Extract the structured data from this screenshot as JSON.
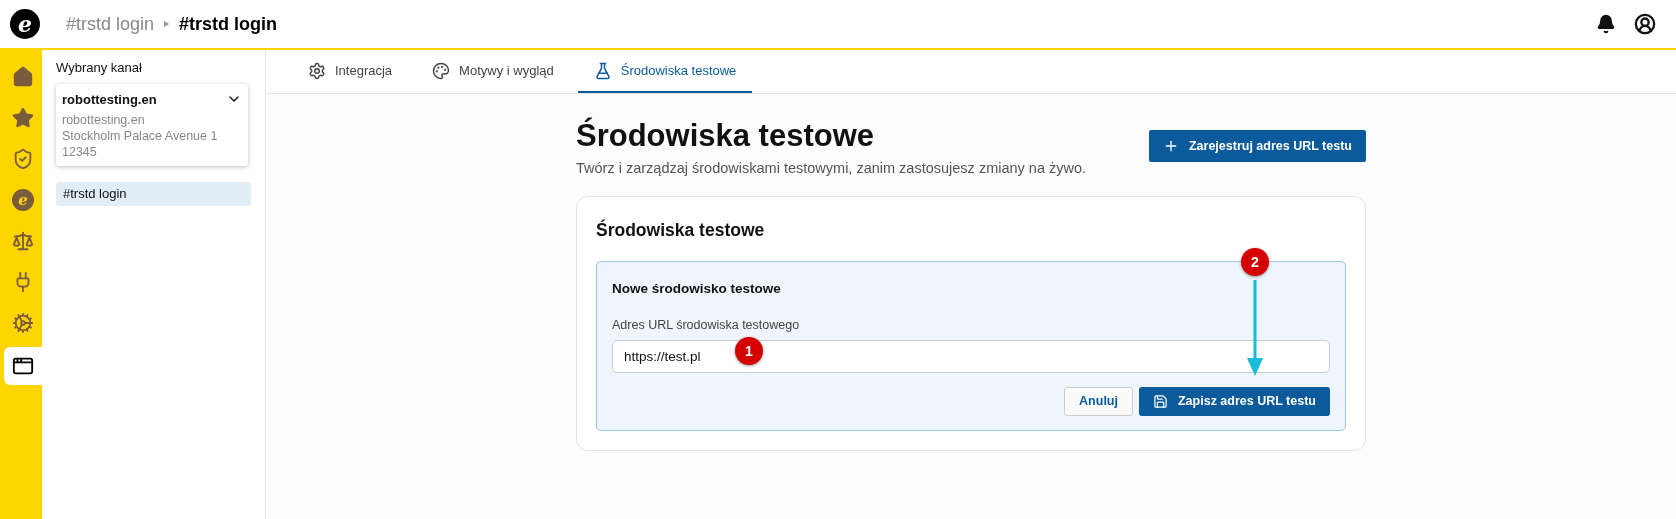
{
  "header": {
    "logo": "e",
    "breadcrumb": [
      {
        "label": "#trstd login",
        "current": false
      },
      {
        "label": "#trstd login",
        "current": true
      }
    ]
  },
  "rail": [
    {
      "kind": "home",
      "selected": false
    },
    {
      "kind": "star",
      "selected": false
    },
    {
      "kind": "shield",
      "selected": false
    },
    {
      "kind": "logo",
      "glyph": "e",
      "selected": false
    },
    {
      "kind": "scale",
      "selected": false
    },
    {
      "kind": "plug",
      "selected": false
    },
    {
      "kind": "gear",
      "selected": false
    },
    {
      "kind": "window",
      "selected": true
    }
  ],
  "sidebar": {
    "label": "Wybrany kanał",
    "channel": {
      "name": "robottesting.en",
      "lines": [
        "robottesting.en",
        "Stockholm Palace Avenue 1",
        "12345"
      ]
    },
    "items": [
      {
        "label": "#trstd login",
        "selected": true
      }
    ]
  },
  "tabs": [
    {
      "kind": "gear",
      "label": "Integracja",
      "selected": false
    },
    {
      "kind": "palette",
      "label": "Motywy i wygląd",
      "selected": false
    },
    {
      "kind": "flask",
      "label": "Środowiska testowe",
      "selected": true
    }
  ],
  "page": {
    "title": "Środowiska testowe",
    "subtitle": "Twórz i zarządzaj środowiskami testowymi, zanim zastosujesz zmiany na żywo.",
    "register_button": "Zarejestruj adres URL testu"
  },
  "card": {
    "title": "Środowiska testowe",
    "form": {
      "title": "Nowe środowisko testowe",
      "field_label": "Adres URL środowiska testowego",
      "value": "https://test.pl",
      "cancel": "Anuluj",
      "save": "Zapisz adres URL testu"
    }
  },
  "annotations": [
    {
      "label": "1"
    },
    {
      "label": "2"
    }
  ]
}
